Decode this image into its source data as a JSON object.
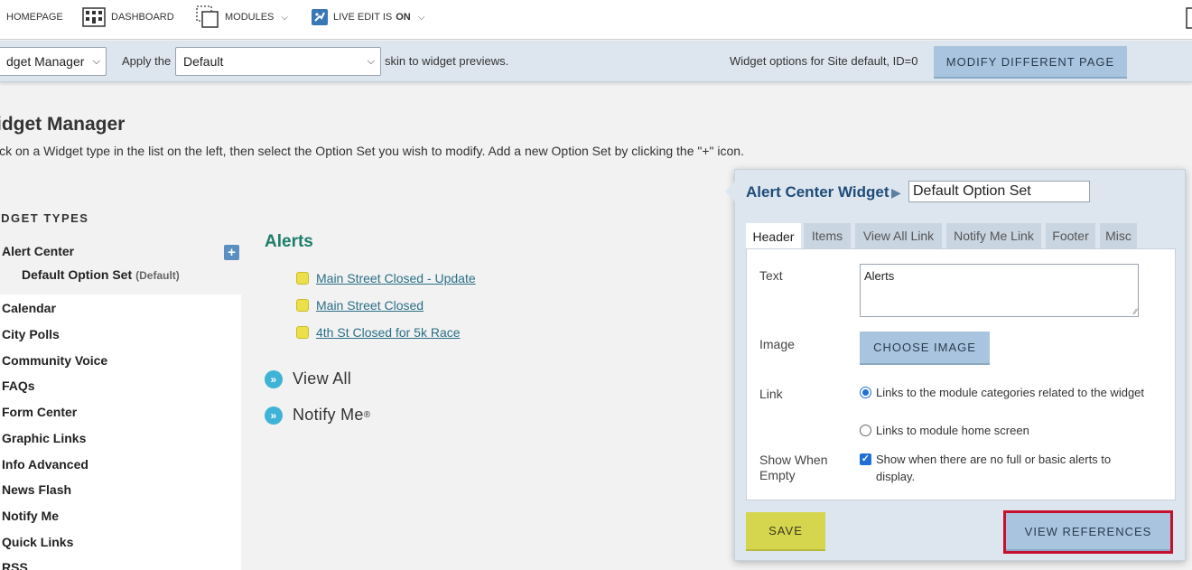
{
  "topnav": {
    "homepage": "HOMEPAGE",
    "dashboard": "DASHBOARD",
    "modules": "MODULES",
    "live_edit_prefix": "LIVE EDIT IS",
    "live_edit_state": "ON"
  },
  "toolbar": {
    "manager_select": "dget Manager",
    "apply_the": "Apply the",
    "skin_select": "Default",
    "skin_suffix": "skin to widget previews.",
    "widget_options": "Widget options for Site default, ID=0",
    "modify_button": "MODIFY DIFFERENT PAGE"
  },
  "main": {
    "title": "idget Manager",
    "description": "ick on a Widget type in the list on the left, then select the Option Set you wish to modify. Add a new Option Set by clicking the \"+\" icon."
  },
  "widget_types": {
    "heading": "IDGET TYPES",
    "active": "Alert Center",
    "add_symbol": "+",
    "option_set": "Default Option Set",
    "option_set_tag": "(Default)",
    "items": [
      "Calendar",
      "City Polls",
      "Community Voice",
      "FAQs",
      "Form Center",
      "Graphic Links",
      "Info Advanced",
      "News Flash",
      "Notify Me",
      "Quick Links",
      "RSS"
    ]
  },
  "preview": {
    "title": "Alerts",
    "alerts": [
      "Main Street Closed - Update",
      "Main Street Closed",
      "4th St Closed for 5k Race"
    ],
    "view_all": "View All",
    "notify_me": "Notify Me",
    "notify_reg": "®"
  },
  "panel": {
    "title": "Alert Center Widget",
    "option_set_name": "Default Option Set",
    "tabs": [
      "Header",
      "Items",
      "View All Link",
      "Notify Me Link",
      "Footer",
      "Misc"
    ],
    "text_label": "Text",
    "text_value": "Alerts",
    "image_label": "Image",
    "choose_image": "CHOOSE IMAGE",
    "link_label": "Link",
    "link_option_1": "Links to the module categories related to the widget",
    "link_option_2": "Links to module home screen",
    "show_when_empty_label": "Show When Empty",
    "show_when_empty_option": "Show when there are no full or basic alerts to display.",
    "save": "SAVE",
    "view_references": "VIEW REFERENCES"
  },
  "colors": {
    "accent_blue": "#a9c4de",
    "save_yellow": "#d5d64e",
    "highlight_red": "#c8102e",
    "alerts_green": "#1e7d6a"
  }
}
